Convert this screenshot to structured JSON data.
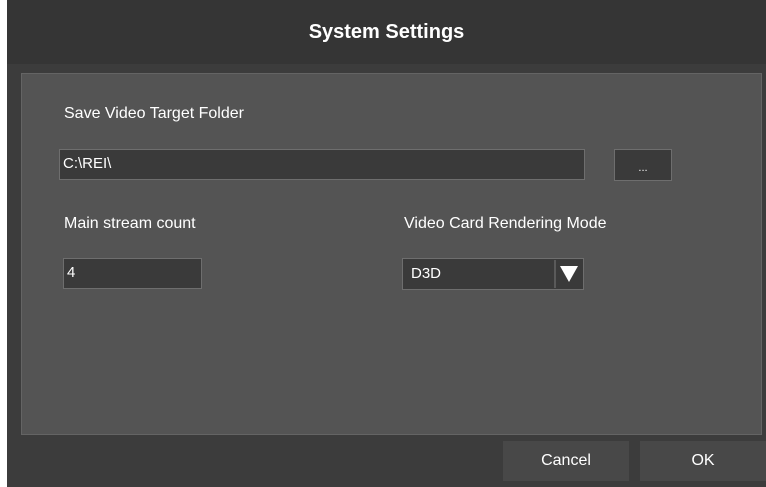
{
  "dialog": {
    "title": "System Settings"
  },
  "settings": {
    "save_folder": {
      "label": "Save Video Target Folder",
      "value": "C:\\REI\\",
      "browse_label": "..."
    },
    "main_stream": {
      "label": "Main stream count",
      "value": "4"
    },
    "render_mode": {
      "label": "Video Card Rendering Mode",
      "value": "D3D",
      "icon": "dropdown-arrow-icon"
    }
  },
  "footer": {
    "cancel_label": "Cancel",
    "ok_label": "OK"
  },
  "colors": {
    "title_bar": "#353535",
    "panel": "#545454",
    "field": "#3a3a3a",
    "text": "#ffffff"
  }
}
